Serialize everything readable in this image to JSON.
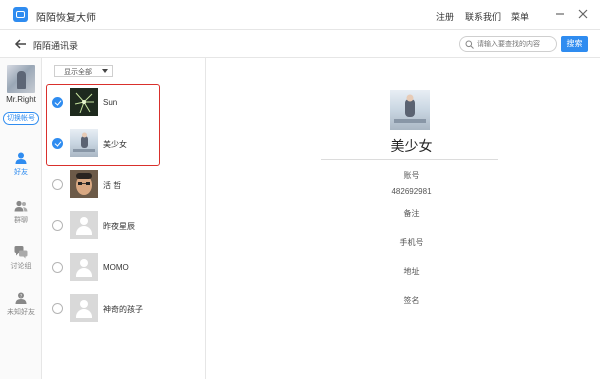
{
  "app": {
    "title": "陌陌恢复大师",
    "menu": [
      "注册",
      "联系我们",
      "菜单"
    ]
  },
  "nav": {
    "title": "陌陌通讯录",
    "search_placeholder": "请输入要查找的内容",
    "search_button": "搜索"
  },
  "sidebar": {
    "username": "Mr.Right",
    "switch_account": "切换帐号",
    "items": [
      {
        "label": "好友",
        "icon": "person-icon",
        "active": true
      },
      {
        "label": "群聊",
        "icon": "group-icon",
        "active": false
      },
      {
        "label": "讨论组",
        "icon": "chat-bubbles-icon",
        "active": false
      },
      {
        "label": "未知好友",
        "icon": "unknown-person-icon",
        "active": false
      }
    ]
  },
  "list": {
    "filter": "显示全部",
    "contacts": [
      {
        "name": "Sun",
        "checked": true,
        "avatar": "sun-photo"
      },
      {
        "name": "美少女",
        "checked": true,
        "avatar": "girl-photo"
      },
      {
        "name": "活 哲",
        "checked": false,
        "avatar": "man-photo"
      },
      {
        "name": "昨夜星辰",
        "checked": false,
        "avatar": "default-avatar"
      },
      {
        "name": "MOMO",
        "checked": false,
        "avatar": "default-avatar"
      },
      {
        "name": "神奇的孩子",
        "checked": false,
        "avatar": "default-avatar"
      }
    ]
  },
  "detail": {
    "name": "美少女",
    "fields": [
      {
        "label": "账号",
        "value": "482692981"
      },
      {
        "label": "备注",
        "value": ""
      },
      {
        "label": "手机号",
        "value": ""
      },
      {
        "label": "地址",
        "value": ""
      },
      {
        "label": "签名",
        "value": ""
      }
    ]
  },
  "colors": {
    "accent": "#2f8cf0",
    "highlight_border": "#d9302c"
  }
}
